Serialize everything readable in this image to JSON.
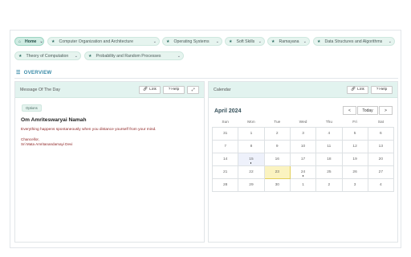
{
  "tabs": [
    {
      "label": "Home",
      "active": true
    },
    {
      "label": "Computer Organization and Architecture"
    },
    {
      "label": "Operating Systems"
    },
    {
      "label": "Soft Skills"
    },
    {
      "label": "Ramayana"
    },
    {
      "label": "Data Structures and Algorithms"
    },
    {
      "label": "Theory of Computation"
    },
    {
      "label": "Probability and Random Processes"
    }
  ],
  "overview": {
    "label": "OVERVIEW",
    "icon": "list-icon"
  },
  "message": {
    "header": "Message Of The Day",
    "link_label": "Link",
    "help_label": "Help",
    "expand_icon": "expand-icon",
    "options_label": "Options",
    "title": "Om Amriteswaryai Namah",
    "quote": "Everything happens spontaneously when you distance yourself from your mind.",
    "sig_role": "Chancellor,",
    "sig_name": "Sri Mata Amritanandamayi Devi"
  },
  "calendar": {
    "header": "Calendar",
    "link_label": "Link",
    "help_label": "Help",
    "month": "April 2024",
    "prev": "<",
    "today_label": "Today",
    "next": ">",
    "weekdays": [
      "Sun",
      "Mon",
      "Tue",
      "Wed",
      "Thu",
      "Fri",
      "Sat"
    ],
    "weeks": [
      [
        "31",
        "1",
        "2",
        "3",
        "4",
        "5",
        "6"
      ],
      [
        "7",
        "8",
        "9",
        "10",
        "11",
        "12",
        "13"
      ],
      [
        "14",
        "15",
        "16",
        "17",
        "18",
        "19",
        "20"
      ],
      [
        "21",
        "22",
        "23",
        "24",
        "25",
        "26",
        "27"
      ],
      [
        "28",
        "29",
        "30",
        "1",
        "2",
        "3",
        "4"
      ]
    ],
    "today": "23",
    "event_days": [
      "15",
      "24"
    ],
    "colors": {
      "today_bg": "#fbf3c0",
      "accent": "#3a8ba8",
      "header_bg": "#e2f3ef"
    }
  }
}
